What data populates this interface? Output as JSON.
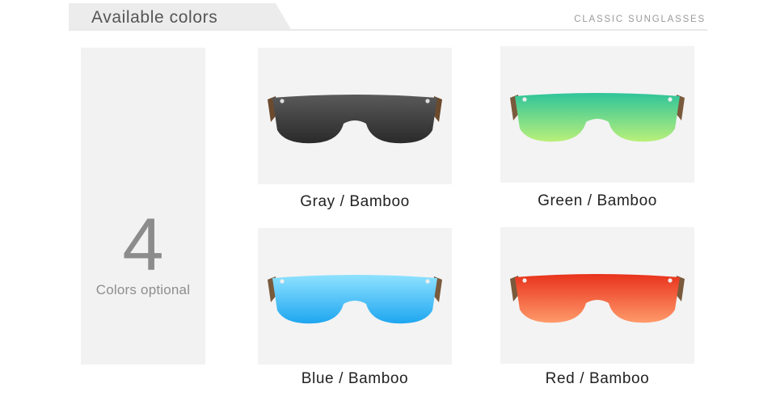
{
  "header": {
    "title": "Available colors",
    "subtitle": "CLASSIC SUNGLASSES"
  },
  "count_panel": {
    "number": "4",
    "label": "Colors optional"
  },
  "products": [
    {
      "label": "Gray / Bamboo",
      "lens_color": "#2a2a2a",
      "lens_highlight": "#5a5a5a"
    },
    {
      "label": "Green / Bamboo",
      "lens_color": "#2fc49a",
      "lens_highlight": "#b9f07a"
    },
    {
      "label": "Blue / Bamboo",
      "lens_color": "#1ea6f0",
      "lens_highlight": "#8fe2ff"
    },
    {
      "label": "Red / Bamboo",
      "lens_color": "#e8321c",
      "lens_highlight": "#ff9a6a"
    }
  ],
  "colors": {
    "panel_background": "#f2f2f2",
    "card_background": "#f3f3f3",
    "header_tab": "#ececec",
    "muted_text": "#8c8c8c"
  }
}
